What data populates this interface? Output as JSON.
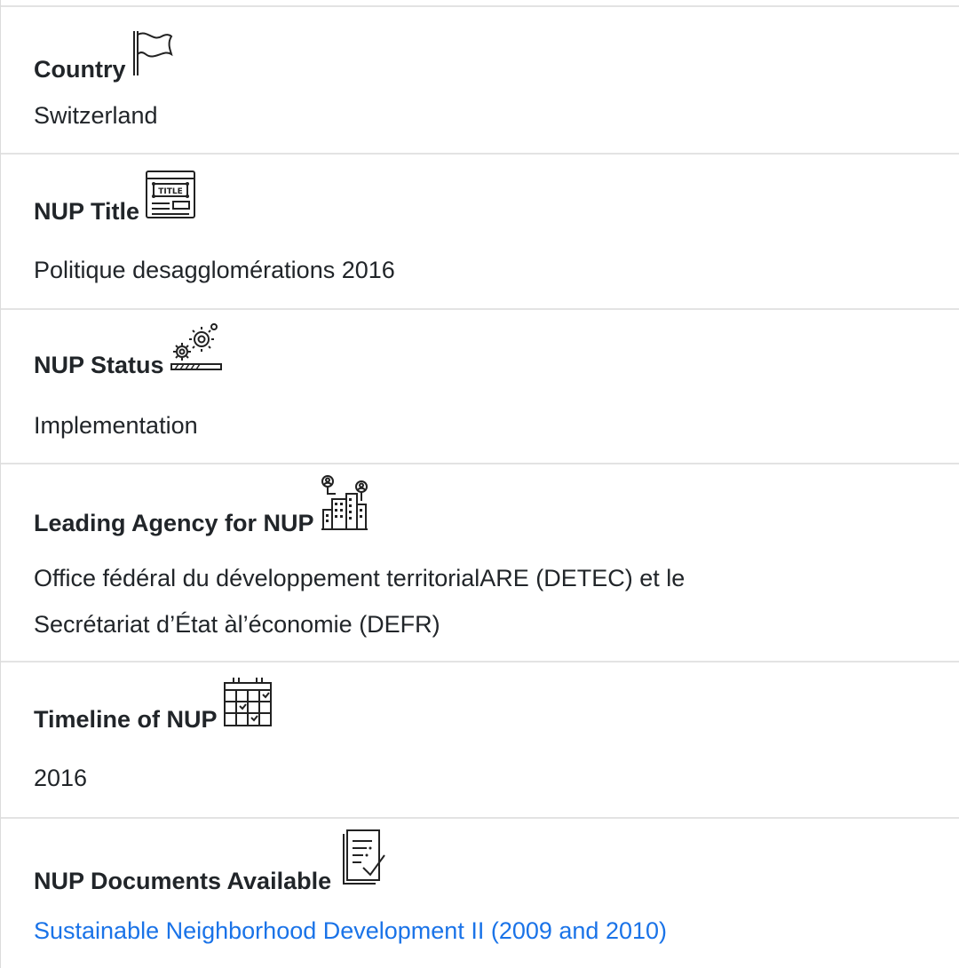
{
  "fields": [
    {
      "label": "Country",
      "icon": "flag-icon",
      "value": "Switzerland"
    },
    {
      "label": "NUP Title",
      "icon": "title-window-icon",
      "value": "Politique desagglomérations 2016"
    },
    {
      "label": "NUP Status",
      "icon": "gears-progress-icon",
      "value": "Implementation"
    },
    {
      "label": "Leading Agency for NUP",
      "icon": "agency-buildings-icon",
      "value_lines": [
        "Office fédéral du développement territorialARE (DETEC) et le",
        "Secrétariat d’État àl’économie (DEFR)"
      ]
    },
    {
      "label": "Timeline of NUP",
      "icon": "calendar-icon",
      "value": "2016"
    },
    {
      "label": "NUP Documents Available",
      "icon": "document-check-icon",
      "value": "Sustainable Neighborhood Development II (2009 and 2010)"
    }
  ],
  "colors": {
    "text": "#212529",
    "link": "#1a73e8",
    "divider": "#e3e3e3"
  }
}
